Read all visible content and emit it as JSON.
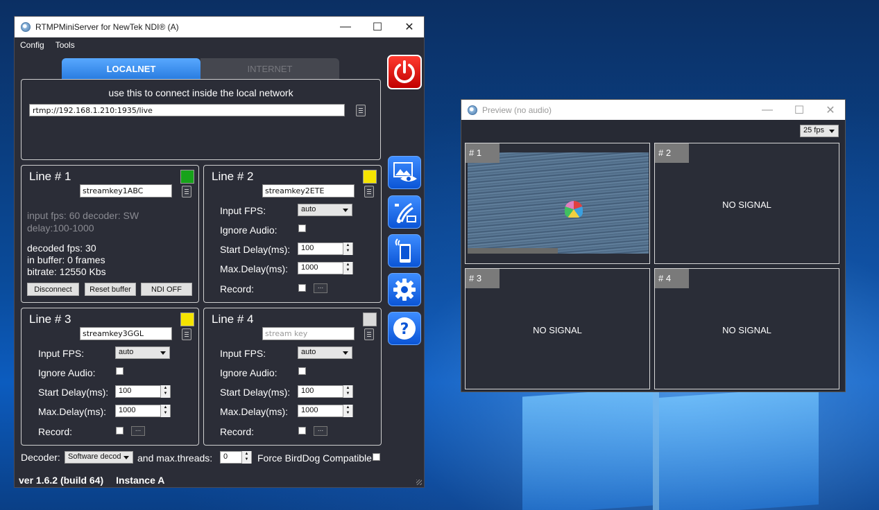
{
  "main_window": {
    "title": "RTMPMiniServer for NewTek NDI®  (A)",
    "menu": [
      "Config",
      "Tools"
    ],
    "tabs": [
      "LOCALNET",
      "INTERNET"
    ],
    "local_hint": "use this to connect inside the local network",
    "rtmp_url": "rtmp://192.168.1.210:1935/live"
  },
  "line1": {
    "title": "Line # 1",
    "led_color": "#17a31a",
    "stream_key": "streamkey1ABC",
    "info_line1": "input fps: 60  decoder: SW",
    "info_line2": "delay:100-1000",
    "decoded": "decoded fps: 30",
    "buffer": "in buffer: 0 frames",
    "bitrate": "bitrate: 12550 Kbs",
    "btn_disconnect": "Disconnect",
    "btn_reset": "Reset buffer",
    "btn_ndi": "NDI OFF"
  },
  "line2": {
    "title": "Line # 2",
    "led_color": "#f5e400",
    "stream_key": "streamkey2ETE",
    "input_fps": "auto",
    "start_delay": "100",
    "max_delay": "1000"
  },
  "line3": {
    "title": "Line # 3",
    "led_color": "#f5e400",
    "stream_key": "streamkey3GGL",
    "input_fps": "auto",
    "start_delay": "100",
    "max_delay": "1000"
  },
  "line4": {
    "title": "Line # 4",
    "led_color": "#d9d9d9",
    "stream_key_placeholder": "stream key",
    "input_fps": "auto",
    "start_delay": "100",
    "max_delay": "1000"
  },
  "labels": {
    "input_fps": "Input FPS:",
    "ignore_audio": "Ignore Audio:",
    "start_delay": "Start Delay(ms):",
    "max_delay": "Max.Delay(ms):",
    "record": "Record:"
  },
  "bottom": {
    "decoder_label": "Decoder:",
    "decoder_value": "Software decod",
    "threads_label": "and max.threads:",
    "threads_value": "0",
    "birddog_label": "Force BirdDog Compatible",
    "version": "ver 1.6.2 (build 64)",
    "instance": "Instance A"
  },
  "side_buttons": [
    "power-icon",
    "preview-icon",
    "network-icon",
    "phone-icon",
    "gear-icon",
    "help-icon"
  ],
  "preview_window": {
    "title": "Preview (no audio)",
    "fps": "25 fps",
    "cells": [
      {
        "tag": "# 1"
      },
      {
        "tag": "# 2",
        "status": "NO SIGNAL"
      },
      {
        "tag": "# 3",
        "status": "NO SIGNAL"
      },
      {
        "tag": "# 4",
        "status": "NO SIGNAL"
      }
    ]
  }
}
